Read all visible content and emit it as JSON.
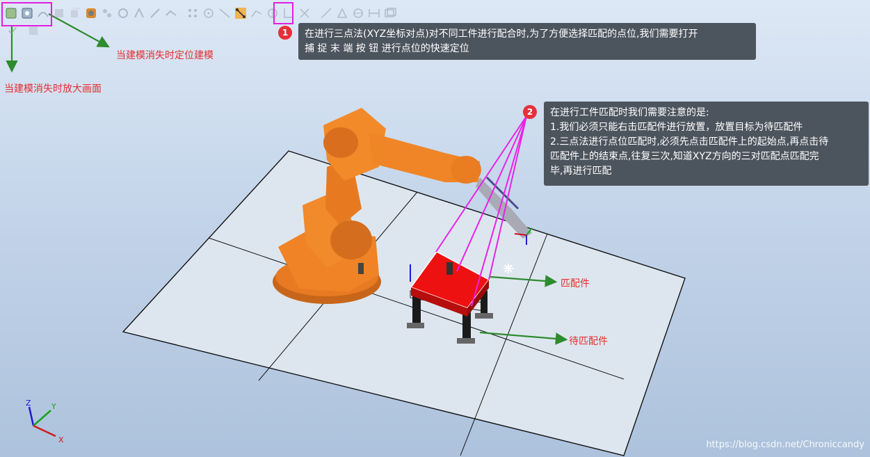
{
  "annotations": {
    "zoom_note": "当建模消失时放大画面",
    "locate_note": "当建模消失时定位建模"
  },
  "tooltips": [
    {
      "number": "1",
      "lines": [
        "在进行三点法(XYZ坐标对点)对不同工件进行配合时,为了方便选择匹配的点位,我们需要打开",
        "捕 捉 末 端 按 钮 进行点位的快速定位"
      ]
    },
    {
      "number": "2",
      "lines": [
        "在进行工件匹配时我们需要注意的是:",
        "1.我们必须只能右击匹配件进行放置，放置目标为待匹配件",
        "2.三点法进行点位匹配时,必须先点击匹配件上的起始点,再点击待",
        "匹配件上的结束点,往复三次,知道XYZ方向的三对匹配点匹配完",
        "毕,再进行匹配"
      ]
    }
  ],
  "callouts": {
    "matching_part": "匹配件",
    "target_part": "待匹配件"
  },
  "axes": {
    "x": "X",
    "y": "Y",
    "z": "Z"
  },
  "watermark": "https://blog.csdn.net/Chroniccandy",
  "toolbar_icons": [
    "view-all-icon",
    "view-center-icon",
    "select-curve-icon",
    "select-surface-icon",
    "select-body-icon",
    "select-part-icon",
    "select-group-icon",
    "select-mechanism-icon",
    "select-target-icon",
    "select-frame-icon",
    "select-path-icon",
    "snap-object-icon",
    "snap-center-icon",
    "snap-midpoint-icon",
    "snap-edge-icon",
    "snap-end-icon",
    "snap-grid-icon",
    "measure-point-icon",
    "measure-angle-icon",
    "measure-diameter-icon",
    "measure-distance-icon",
    "measure-shortest-icon"
  ],
  "colors": {
    "highlight": "#e020e0",
    "annotation_text": "#e2302f",
    "guide_arrow": "#2e8b2e",
    "robot": "#f07f21",
    "part_top": "#ee1111",
    "tooltip_bg": "#4c545e"
  }
}
